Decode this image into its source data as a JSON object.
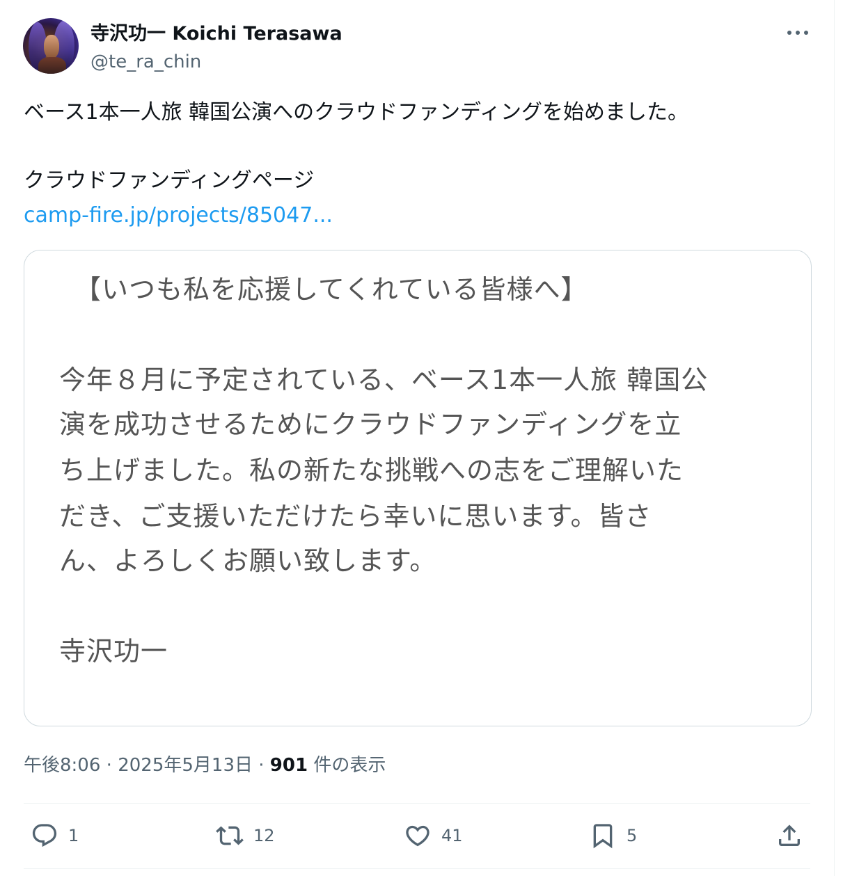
{
  "author": {
    "display_name": "寺沢功一 Koichi Terasawa",
    "handle": "@te_ra_chin"
  },
  "tweet": {
    "line1": "ベース1本一人旅 韓国公演へのクラウドファンディングを始めました。",
    "line2": "クラウドファンディングページ",
    "link": "camp-fire.jp/projects/85047..."
  },
  "card": {
    "heading": "【いつも私を応援してくれている皆様へ】",
    "body_lines": [
      "今年８月に予定されている、ベース1本一人旅 韓国公",
      "演を成功させるためにクラウドファンディングを立",
      "ち上げました。私の新たな挑戦への志をご理解いた",
      "だき、ご支援いただけたら幸いに思います。皆さ",
      "ん、よろしくお願い致します。"
    ],
    "signature": "寺沢功一"
  },
  "meta": {
    "time": "午後8:06",
    "separator": " · ",
    "date": "2025年5月13日",
    "views": "901",
    "views_label": " 件の表示"
  },
  "actions": {
    "reply_count": "1",
    "repost_count": "12",
    "like_count": "41",
    "bookmark_count": "5"
  },
  "icons": [
    "more-icon",
    "reply-icon",
    "repost-icon",
    "like-icon",
    "bookmark-icon",
    "share-icon"
  ],
  "colors": {
    "link": "#1d9bf0",
    "secondary_text": "#536471",
    "primary_text": "#0f1419",
    "border": "#cfd9de"
  }
}
